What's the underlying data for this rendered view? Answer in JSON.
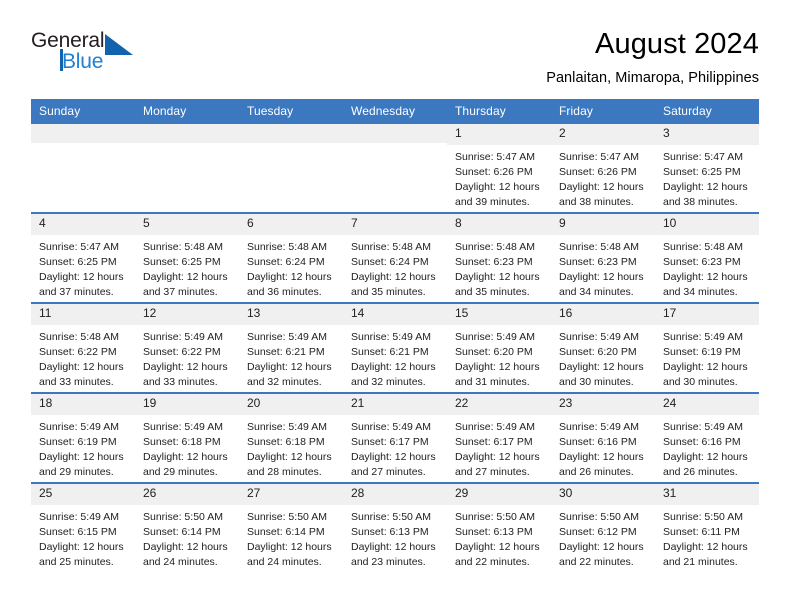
{
  "brand": {
    "name_top": "General",
    "name_bottom": "Blue",
    "accent_color": "#1263ad",
    "text_color": "#231f20"
  },
  "header": {
    "title": "August 2024",
    "subtitle": "Panlaitan, Mimaropa, Philippines"
  },
  "theme": {
    "header_band": "#3b78c0",
    "daynum_band": "#f0f0f0",
    "cell_background": "#ffffff",
    "text": "#222222"
  },
  "weekdays": [
    "Sunday",
    "Monday",
    "Tuesday",
    "Wednesday",
    "Thursday",
    "Friday",
    "Saturday"
  ],
  "weeks": [
    [
      {
        "day": "",
        "detail": ""
      },
      {
        "day": "",
        "detail": ""
      },
      {
        "day": "",
        "detail": ""
      },
      {
        "day": "",
        "detail": ""
      },
      {
        "day": "1",
        "detail": "Sunrise: 5:47 AM\nSunset: 6:26 PM\nDaylight: 12 hours\nand 39 minutes."
      },
      {
        "day": "2",
        "detail": "Sunrise: 5:47 AM\nSunset: 6:26 PM\nDaylight: 12 hours\nand 38 minutes."
      },
      {
        "day": "3",
        "detail": "Sunrise: 5:47 AM\nSunset: 6:25 PM\nDaylight: 12 hours\nand 38 minutes."
      }
    ],
    [
      {
        "day": "4",
        "detail": "Sunrise: 5:47 AM\nSunset: 6:25 PM\nDaylight: 12 hours\nand 37 minutes."
      },
      {
        "day": "5",
        "detail": "Sunrise: 5:48 AM\nSunset: 6:25 PM\nDaylight: 12 hours\nand 37 minutes."
      },
      {
        "day": "6",
        "detail": "Sunrise: 5:48 AM\nSunset: 6:24 PM\nDaylight: 12 hours\nand 36 minutes."
      },
      {
        "day": "7",
        "detail": "Sunrise: 5:48 AM\nSunset: 6:24 PM\nDaylight: 12 hours\nand 35 minutes."
      },
      {
        "day": "8",
        "detail": "Sunrise: 5:48 AM\nSunset: 6:23 PM\nDaylight: 12 hours\nand 35 minutes."
      },
      {
        "day": "9",
        "detail": "Sunrise: 5:48 AM\nSunset: 6:23 PM\nDaylight: 12 hours\nand 34 minutes."
      },
      {
        "day": "10",
        "detail": "Sunrise: 5:48 AM\nSunset: 6:23 PM\nDaylight: 12 hours\nand 34 minutes."
      }
    ],
    [
      {
        "day": "11",
        "detail": "Sunrise: 5:48 AM\nSunset: 6:22 PM\nDaylight: 12 hours\nand 33 minutes."
      },
      {
        "day": "12",
        "detail": "Sunrise: 5:49 AM\nSunset: 6:22 PM\nDaylight: 12 hours\nand 33 minutes."
      },
      {
        "day": "13",
        "detail": "Sunrise: 5:49 AM\nSunset: 6:21 PM\nDaylight: 12 hours\nand 32 minutes."
      },
      {
        "day": "14",
        "detail": "Sunrise: 5:49 AM\nSunset: 6:21 PM\nDaylight: 12 hours\nand 32 minutes."
      },
      {
        "day": "15",
        "detail": "Sunrise: 5:49 AM\nSunset: 6:20 PM\nDaylight: 12 hours\nand 31 minutes."
      },
      {
        "day": "16",
        "detail": "Sunrise: 5:49 AM\nSunset: 6:20 PM\nDaylight: 12 hours\nand 30 minutes."
      },
      {
        "day": "17",
        "detail": "Sunrise: 5:49 AM\nSunset: 6:19 PM\nDaylight: 12 hours\nand 30 minutes."
      }
    ],
    [
      {
        "day": "18",
        "detail": "Sunrise: 5:49 AM\nSunset: 6:19 PM\nDaylight: 12 hours\nand 29 minutes."
      },
      {
        "day": "19",
        "detail": "Sunrise: 5:49 AM\nSunset: 6:18 PM\nDaylight: 12 hours\nand 29 minutes."
      },
      {
        "day": "20",
        "detail": "Sunrise: 5:49 AM\nSunset: 6:18 PM\nDaylight: 12 hours\nand 28 minutes."
      },
      {
        "day": "21",
        "detail": "Sunrise: 5:49 AM\nSunset: 6:17 PM\nDaylight: 12 hours\nand 27 minutes."
      },
      {
        "day": "22",
        "detail": "Sunrise: 5:49 AM\nSunset: 6:17 PM\nDaylight: 12 hours\nand 27 minutes."
      },
      {
        "day": "23",
        "detail": "Sunrise: 5:49 AM\nSunset: 6:16 PM\nDaylight: 12 hours\nand 26 minutes."
      },
      {
        "day": "24",
        "detail": "Sunrise: 5:49 AM\nSunset: 6:16 PM\nDaylight: 12 hours\nand 26 minutes."
      }
    ],
    [
      {
        "day": "25",
        "detail": "Sunrise: 5:49 AM\nSunset: 6:15 PM\nDaylight: 12 hours\nand 25 minutes."
      },
      {
        "day": "26",
        "detail": "Sunrise: 5:50 AM\nSunset: 6:14 PM\nDaylight: 12 hours\nand 24 minutes."
      },
      {
        "day": "27",
        "detail": "Sunrise: 5:50 AM\nSunset: 6:14 PM\nDaylight: 12 hours\nand 24 minutes."
      },
      {
        "day": "28",
        "detail": "Sunrise: 5:50 AM\nSunset: 6:13 PM\nDaylight: 12 hours\nand 23 minutes."
      },
      {
        "day": "29",
        "detail": "Sunrise: 5:50 AM\nSunset: 6:13 PM\nDaylight: 12 hours\nand 22 minutes."
      },
      {
        "day": "30",
        "detail": "Sunrise: 5:50 AM\nSunset: 6:12 PM\nDaylight: 12 hours\nand 22 minutes."
      },
      {
        "day": "31",
        "detail": "Sunrise: 5:50 AM\nSunset: 6:11 PM\nDaylight: 12 hours\nand 21 minutes."
      }
    ]
  ]
}
